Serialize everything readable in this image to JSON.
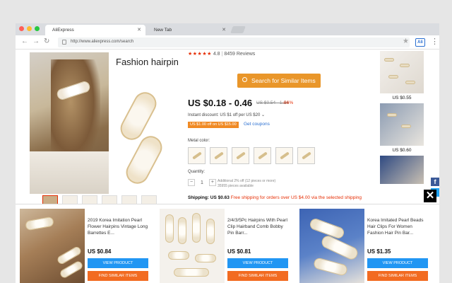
{
  "browser": {
    "tabs": [
      {
        "label": "AliExpress",
        "active": true
      },
      {
        "label": "New Tab",
        "active": false
      }
    ],
    "url": "http://www.aliexpress.com/search",
    "extension_label": "Ali"
  },
  "product": {
    "title": "Fashion hairpin",
    "rating_value": "4.8",
    "reviews": "8459 Reviews",
    "search_similar_label": "Search for Similar Items",
    "price_range": "US $0.18 - 0.46",
    "old_price": "US $0.54 - 1.34",
    "discount": "-66%",
    "instant_discount": "Instant discount: US $1 off per US $20",
    "coupon_tag": "US $1.00 off on US $15.00",
    "coupon_link": "Get coupons",
    "metal_color_label": "Metal color:",
    "quantity_label": "Quantity:",
    "quantity_value": "1",
    "quantity_note_1": "Additional 2% off (12 pieces or more)",
    "quantity_note_2": "35955 pieces available",
    "shipping_label": "Shipping: US $0.63",
    "shipping_promo": "Free shipping for orders over US $4.00 via the selected shipping"
  },
  "sidebar": {
    "prices": [
      "US $0.55",
      "US $0.60"
    ]
  },
  "overlay": {
    "close_label": "✕",
    "cards": [
      {
        "title": "2019 Korea Imitation Pearl Flower Hairpins Vintage Long Barrettes E...",
        "price": "US $0.84",
        "view_label": "VIEW PRODUCT",
        "find_label": "FIND SIMILAR ITEMS"
      },
      {
        "title": "2/4/3/5Pc Hairpins With Pearl Clip Hairband Comb Bobby Pin Barr...",
        "price": "US $0.81",
        "view_label": "VIEW PRODUCT",
        "find_label": "FIND SIMILAR ITEMS"
      },
      {
        "title": "Korea Imitated Pearl Beads Hair Clips For Women Fashion Hair Pin Bar...",
        "price": "US $1.35",
        "view_label": "VIEW PRODUCT",
        "find_label": "FIND SIMILAR ITEMS"
      }
    ]
  },
  "colors": {
    "aliexpress_red": "#e62e04",
    "search_button": "#e9962a",
    "view_button": "#2196f3",
    "find_button": "#f26b21"
  }
}
